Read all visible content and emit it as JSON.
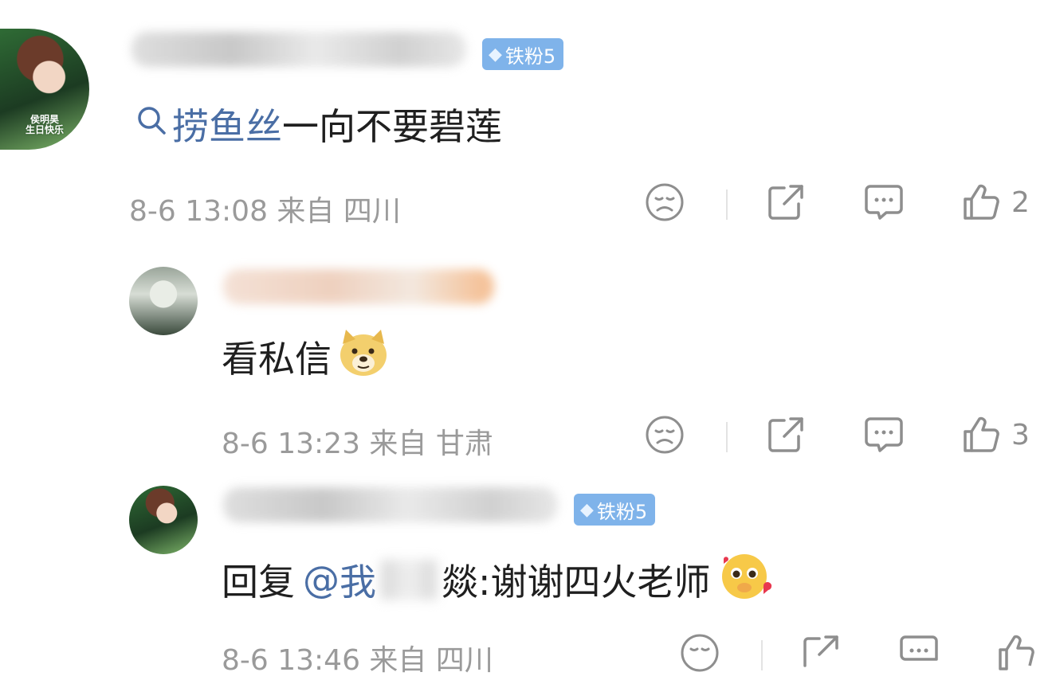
{
  "comments": [
    {
      "badge": "铁粉5",
      "avatar_text_1": "侯明昊",
      "avatar_text_2": "生日快乐",
      "link_text": "捞鱼丝",
      "body_text": "一向不要碧莲",
      "meta": "8-6 13:08 来自 四川",
      "likes": "2"
    },
    {
      "body_text": "看私信",
      "meta": "8-6 13:23 来自 甘肃",
      "likes": "3"
    },
    {
      "badge": "铁粉5",
      "reply_prefix": "回复",
      "mention_at": "@",
      "mention_visible_start": "我",
      "mention_visible_end": "燚",
      "body_text": ":谢谢四火老师",
      "meta": "8-6 13:46 来自 四川"
    }
  ],
  "icons": {
    "dislike": "sad-face-icon",
    "share": "share-icon",
    "comment": "comment-bubble-icon",
    "like": "thumbs-up-icon",
    "search": "search-icon"
  },
  "colors": {
    "link": "#4a6ea5",
    "badge": "#7fb3ea",
    "meta": "#9a9a9a"
  }
}
